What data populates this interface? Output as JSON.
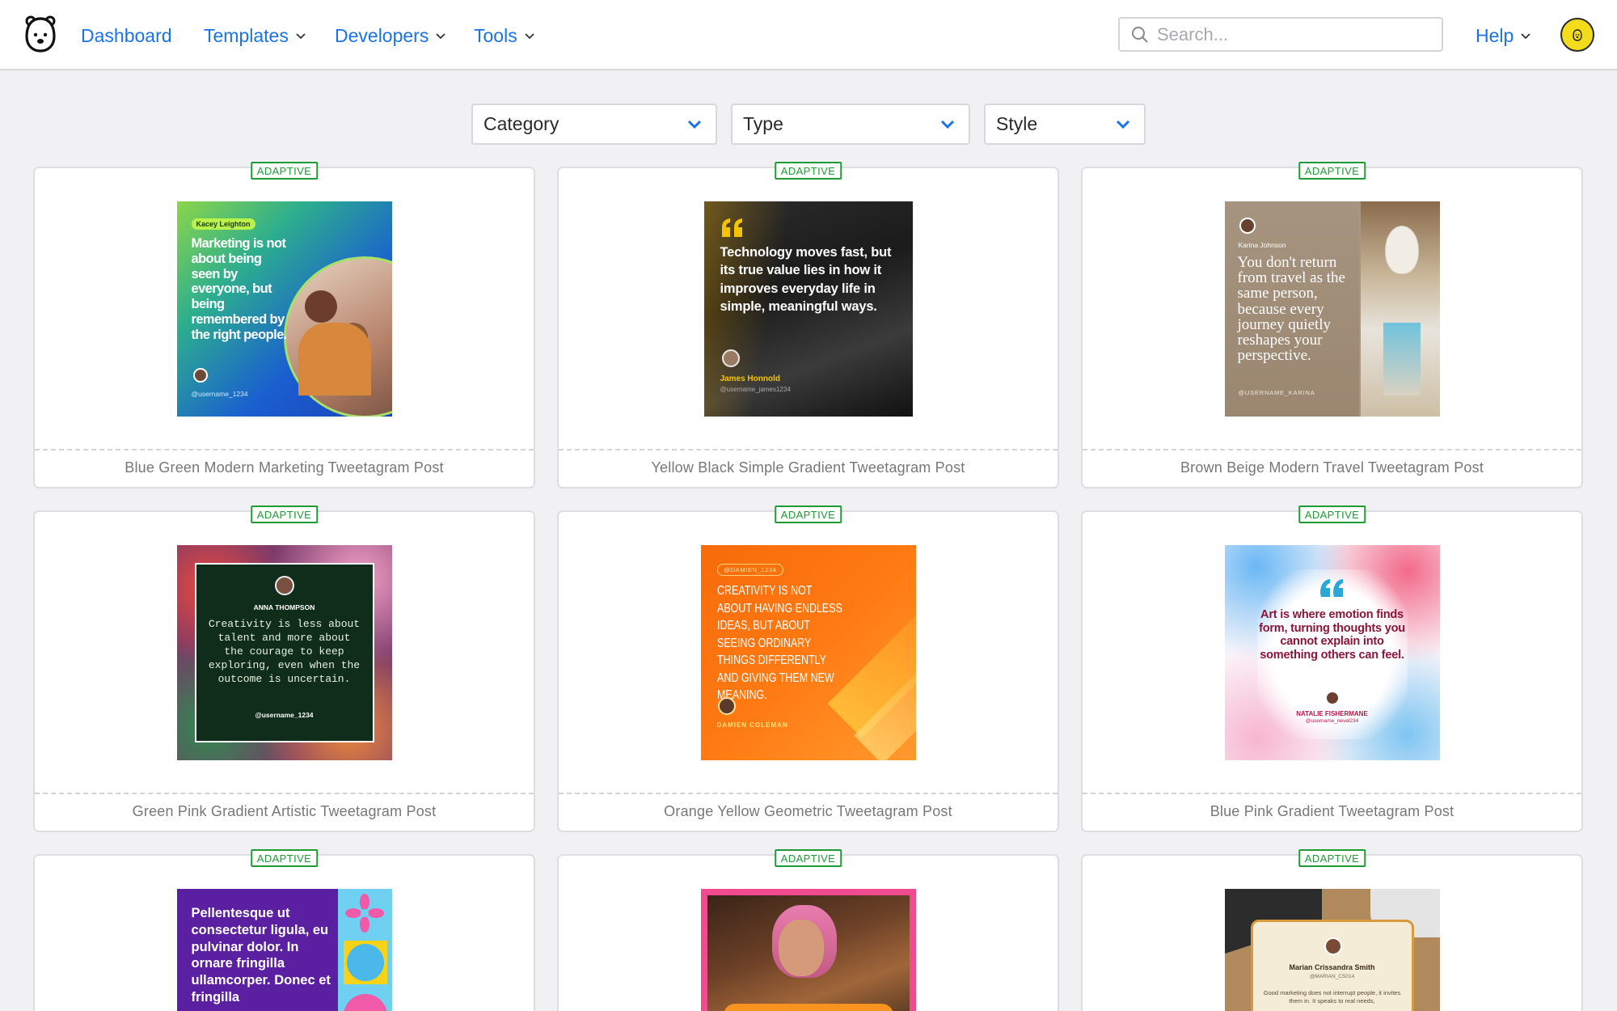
{
  "nav": {
    "dashboard": "Dashboard",
    "templates": "Templates",
    "developers": "Developers",
    "tools": "Tools",
    "help": "Help",
    "search_placeholder": "Search..."
  },
  "filters": {
    "category": "Category",
    "type": "Type",
    "style": "Style"
  },
  "colors": {
    "link": "#1a73e8",
    "badge": "#1d9b36",
    "background": "#f1f1f3",
    "avatar": "#f2dc1b"
  },
  "cards": [
    {
      "badge": "ADAPTIVE",
      "title": "Blue Green Modern Marketing Tweetagram Post",
      "thumb": {
        "name_tag": "Kacey Leighton",
        "quote": "Marketing is not about being seen by everyone, but being remembered by the right people.",
        "handle": "@username_1234"
      }
    },
    {
      "badge": "ADAPTIVE",
      "title": "Yellow Black Simple Gradient Tweetagram Post",
      "thumb": {
        "quote": "Technology moves fast, but its true value lies in how it improves everyday life in simple, meaningful ways.",
        "name": "James Honnold",
        "handle": "@username_james1234"
      }
    },
    {
      "badge": "ADAPTIVE",
      "title": "Brown Beige Modern Travel Tweetagram Post",
      "thumb": {
        "name": "Karina Johnson",
        "quote": "You don't return from travel as the same person, because every journey quietly reshapes your perspective.",
        "handle": "@USERNAME_KARINA"
      }
    },
    {
      "badge": "ADAPTIVE",
      "title": "Green Pink Gradient Artistic Tweetagram Post",
      "thumb": {
        "name": "ANNA THOMPSON",
        "quote": "Creativity is less about talent and more about the courage to keep exploring, even when the outcome is uncertain.",
        "handle": "@username_1234"
      }
    },
    {
      "badge": "ADAPTIVE",
      "title": "Orange Yellow Geometric Tweetagram Post",
      "thumb": {
        "handle": "@DAMIEN_1234",
        "quote": "CREATIVITY IS NOT ABOUT HAVING ENDLESS IDEAS, BUT ABOUT SEEING ORDINARY THINGS DIFFERENTLY AND GIVING THEM NEW MEANING.",
        "name": "DAMIEN COLEMAN"
      }
    },
    {
      "badge": "ADAPTIVE",
      "title": "Blue Pink Gradient Tweetagram Post",
      "thumb": {
        "quote": "Art is where emotion finds form, turning thoughts you cannot explain into something others can feel.",
        "name": "NATALIE FISHERMANE",
        "handle": "@username_nevel234"
      }
    },
    {
      "badge": "ADAPTIVE",
      "title": "",
      "thumb": {
        "quote": "Pellentesque ut consectetur ligula, eu pulvinar dolor. In ornare fringilla ullamcorper. Donec et fringilla"
      }
    },
    {
      "badge": "ADAPTIVE",
      "title": "",
      "thumb": {}
    },
    {
      "badge": "ADAPTIVE",
      "title": "",
      "thumb": {
        "name": "Marian Crissandra Smith",
        "handle": "@MARIAN_CS014",
        "quote": "Good marketing does not interrupt people, it invites them in. It speaks to real needs,"
      }
    }
  ]
}
